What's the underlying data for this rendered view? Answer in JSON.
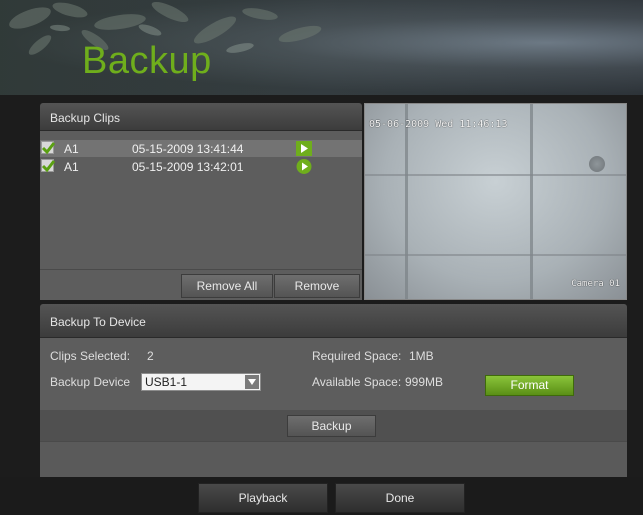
{
  "header": {
    "title": "Backup"
  },
  "clips": {
    "title": "Backup Clips",
    "rows": [
      {
        "camera": "A1",
        "time": "05-15-2009 13:41:44",
        "checked": true
      },
      {
        "camera": "A1",
        "time": "05-15-2009 13:42:01",
        "checked": true
      }
    ],
    "remove_all_label": "Remove All",
    "remove_label": "Remove"
  },
  "preview": {
    "osd_time": "05-06-2009 Wed 11:46:13",
    "osd_camera": "Camera 01"
  },
  "device": {
    "title": "Backup To Device",
    "clips_selected_label": "Clips Selected:",
    "clips_selected_value": "2",
    "required_label": "Required Space:",
    "required_value": "1MB",
    "available_label": "Available Space:",
    "available_value": "999MB",
    "backup_device_label": "Backup Device",
    "backup_device_value": "USB1-1",
    "format_label": "Format",
    "backup_label": "Backup"
  },
  "footer": {
    "playback_label": "Playback",
    "done_label": "Done"
  },
  "colors": {
    "accent_green": "#6fae1c",
    "format_green": "#7ab52a",
    "panel": "#5d5d5d"
  }
}
